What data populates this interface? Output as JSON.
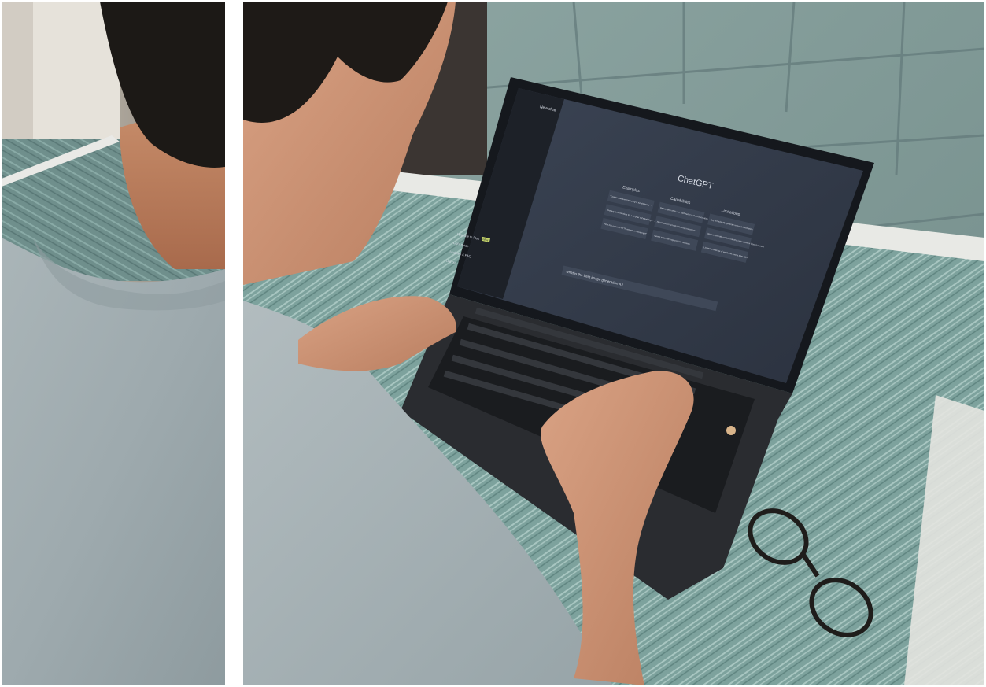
{
  "screen": {
    "sidebar": {
      "new_chat": "New chat",
      "items": [
        "Upgrade to Plus",
        "Light mode",
        "Updates & FAQ",
        "Log out"
      ],
      "plus_badge": "NEW"
    },
    "title": "ChatGPT",
    "columns": [
      {
        "heading": "Examples",
        "cards": [
          "\"Explain quantum computing in simple terms\" →",
          "\"Got any creative ideas for a 10 year old's birthday?\" →",
          "\"How do I make an HTTP request in Javascript?\" →"
        ]
      },
      {
        "heading": "Capabilities",
        "cards": [
          "Remembers what user said earlier in the conversation",
          "Allows user to provide follow-up corrections",
          "Trained to decline inappropriate requests"
        ]
      },
      {
        "heading": "Limitations",
        "cards": [
          "May occasionally generate incorrect information",
          "May occasionally produce harmful instructions or biased content",
          "Limited knowledge of world and events after 2021"
        ]
      }
    ],
    "prompt_value": "what is the best image generation A.I"
  }
}
